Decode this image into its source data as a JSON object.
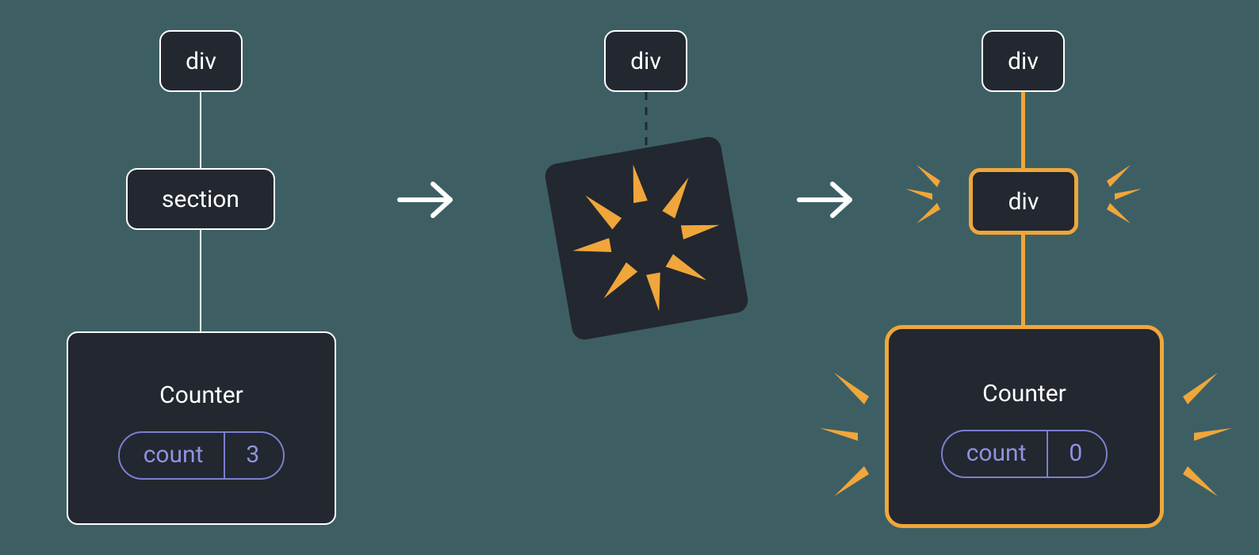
{
  "tree1": {
    "root": {
      "label": "div"
    },
    "mid": {
      "label": "section"
    },
    "leaf": {
      "title": "Counter",
      "state_label": "count",
      "state_value": "3"
    }
  },
  "tree2": {
    "root": {
      "label": "div"
    }
  },
  "tree3": {
    "root": {
      "label": "div"
    },
    "mid": {
      "label": "div"
    },
    "leaf": {
      "title": "Counter",
      "state_label": "count",
      "state_value": "0"
    }
  }
}
